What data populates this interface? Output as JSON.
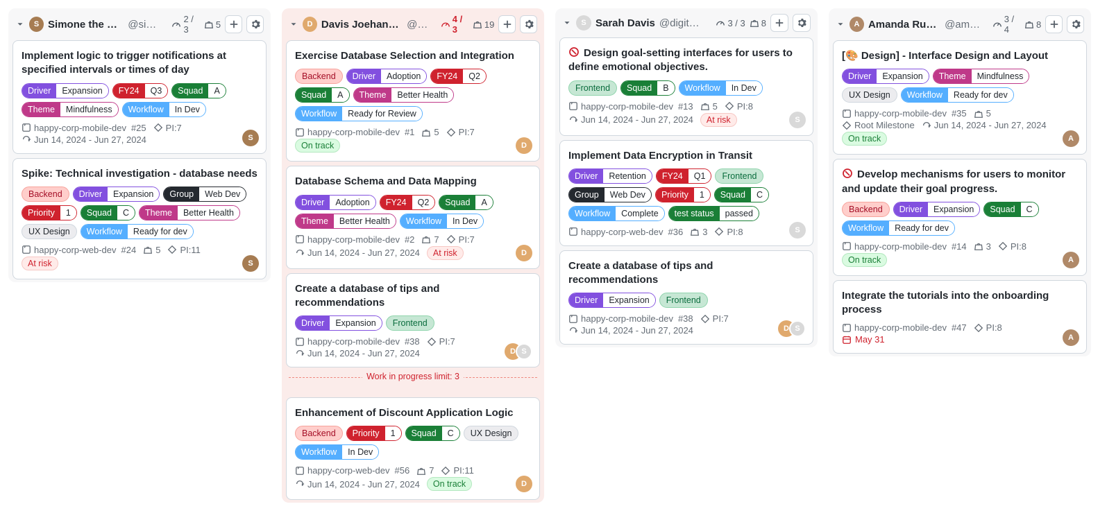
{
  "columns": [
    {
      "id": "simone",
      "over": false,
      "avatarBg": "#a67c52",
      "avatarInitials": "S",
      "name": "Simone the SET",
      "handle": "@sim…",
      "limitText": "2 / 3",
      "limitOver": false,
      "weight": "5",
      "cards": [
        {
          "title": "Implement logic to trigger notifications at specified intervals or times of day",
          "tags": [
            {
              "type": "split",
              "k": "Driver",
              "v": "Expansion",
              "bg": "#8250df",
              "border": "#8250df"
            },
            {
              "type": "split",
              "k": "FY24",
              "v": "Q3",
              "bg": "#cf222e",
              "border": "#cf222e"
            },
            {
              "type": "split",
              "k": "Squad",
              "v": "A",
              "bg": "#1a7f37",
              "border": "#1a7f37"
            },
            {
              "type": "split",
              "k": "Theme",
              "v": "Mindfulness",
              "bg": "#bf3989",
              "border": "#bf3989"
            },
            {
              "type": "split",
              "k": "Workflow",
              "v": "In Dev",
              "bg": "#54aeff",
              "border": "#54aeff"
            }
          ],
          "repo": "happy-corp-mobile-dev",
          "num": "#25",
          "pi": "PI:7",
          "dates": "Jun 14, 2024 - Jun 27, 2024",
          "assignees": [
            {
              "bg": "#a67c52",
              "ini": "S"
            }
          ]
        },
        {
          "title": "Spike: Technical investigation - database needs",
          "tags": [
            {
              "type": "solid",
              "label": "Backend",
              "bg": "#ffcecb",
              "fg": "#a40e26",
              "border": "#f7a39c"
            },
            {
              "type": "split",
              "k": "Driver",
              "v": "Expansion",
              "bg": "#8250df",
              "border": "#8250df"
            },
            {
              "type": "split",
              "k": "Group",
              "v": "Web Dev",
              "bg": "#24292f",
              "border": "#24292f"
            },
            {
              "type": "split",
              "k": "Priority",
              "v": "1",
              "bg": "#cf222e",
              "border": "#cf222e"
            },
            {
              "type": "split",
              "k": "Squad",
              "v": "C",
              "bg": "#1a7f37",
              "border": "#1a7f37"
            },
            {
              "type": "split",
              "k": "Theme",
              "v": "Better Health",
              "bg": "#bf3989",
              "border": "#bf3989"
            },
            {
              "type": "solid",
              "label": "UX Design",
              "bg": "#ececef",
              "fg": "#24292f",
              "border": "#d0d7de"
            },
            {
              "type": "split",
              "k": "Workflow",
              "v": "Ready for dev",
              "bg": "#54aeff",
              "border": "#54aeff"
            }
          ],
          "repo": "happy-corp-web-dev",
          "num": "#24",
          "weight": "5",
          "pi": "PI:11",
          "status": "At risk",
          "statusClass": "status-atrisk",
          "assignees": [
            {
              "bg": "#a67c52",
              "ini": "S"
            }
          ]
        }
      ]
    },
    {
      "id": "davis",
      "over": true,
      "avatarBg": "#e0a96d",
      "avatarInitials": "D",
      "name": "Davis Joehanson",
      "handle": "@d…",
      "limitText": "4 / 3",
      "limitOver": true,
      "weight": "19",
      "wipLimitAfter": 3,
      "wipLimitText": "Work in progress limit: 3",
      "cards": [
        {
          "title": "Exercise Database Selection and Integration",
          "tags": [
            {
              "type": "solid",
              "label": "Backend",
              "bg": "#ffcecb",
              "fg": "#a40e26",
              "border": "#f7a39c"
            },
            {
              "type": "split",
              "k": "Driver",
              "v": "Adoption",
              "bg": "#8250df",
              "border": "#8250df"
            },
            {
              "type": "split",
              "k": "FY24",
              "v": "Q2",
              "bg": "#cf222e",
              "border": "#cf222e"
            },
            {
              "type": "split",
              "k": "Squad",
              "v": "A",
              "bg": "#1a7f37",
              "border": "#1a7f37"
            },
            {
              "type": "split",
              "k": "Theme",
              "v": "Better Health",
              "bg": "#bf3989",
              "border": "#bf3989"
            },
            {
              "type": "split",
              "k": "Workflow",
              "v": "Ready for Review",
              "bg": "#54aeff",
              "border": "#54aeff"
            }
          ],
          "repo": "happy-corp-mobile-dev",
          "num": "#1",
          "weight": "5",
          "pi": "PI:7",
          "status": "On track",
          "statusClass": "status-ontrack",
          "assignees": [
            {
              "bg": "#e0a96d",
              "ini": "D"
            }
          ]
        },
        {
          "title": "Database Schema and Data Mapping",
          "tags": [
            {
              "type": "split",
              "k": "Driver",
              "v": "Adoption",
              "bg": "#8250df",
              "border": "#8250df"
            },
            {
              "type": "split",
              "k": "FY24",
              "v": "Q2",
              "bg": "#cf222e",
              "border": "#cf222e"
            },
            {
              "type": "split",
              "k": "Squad",
              "v": "A",
              "bg": "#1a7f37",
              "border": "#1a7f37"
            },
            {
              "type": "split",
              "k": "Theme",
              "v": "Better Health",
              "bg": "#bf3989",
              "border": "#bf3989"
            },
            {
              "type": "split",
              "k": "Workflow",
              "v": "In Dev",
              "bg": "#54aeff",
              "border": "#54aeff"
            }
          ],
          "repo": "happy-corp-mobile-dev",
          "num": "#2",
          "weight": "7",
          "pi": "PI:7",
          "dates": "Jun 14, 2024 - Jun 27, 2024",
          "status": "At risk",
          "statusClass": "status-atrisk",
          "assignees": [
            {
              "bg": "#e0a96d",
              "ini": "D"
            }
          ]
        },
        {
          "title": "Create a database of tips and recommendations",
          "tags": [
            {
              "type": "split",
              "k": "Driver",
              "v": "Expansion",
              "bg": "#8250df",
              "border": "#8250df"
            },
            {
              "type": "solid",
              "label": "Frontend",
              "bg": "#c6e7d4",
              "fg": "#0a6c3d",
              "border": "#8fd4ac"
            }
          ],
          "repo": "happy-corp-mobile-dev",
          "num": "#38",
          "pi": "PI:7",
          "dates": "Jun 14, 2024 - Jun 27, 2024",
          "assignees": [
            {
              "bg": "#e0a96d",
              "ini": "D"
            },
            {
              "bg": "#d9d9d9",
              "ini": "S"
            }
          ]
        },
        {
          "title": "Enhancement of Discount Application Logic",
          "tags": [
            {
              "type": "solid",
              "label": "Backend",
              "bg": "#ffcecb",
              "fg": "#a40e26",
              "border": "#f7a39c"
            },
            {
              "type": "split",
              "k": "Priority",
              "v": "1",
              "bg": "#cf222e",
              "border": "#cf222e"
            },
            {
              "type": "split",
              "k": "Squad",
              "v": "C",
              "bg": "#1a7f37",
              "border": "#1a7f37"
            },
            {
              "type": "solid",
              "label": "UX Design",
              "bg": "#ececef",
              "fg": "#24292f",
              "border": "#d0d7de"
            },
            {
              "type": "split",
              "k": "Workflow",
              "v": "In Dev",
              "bg": "#54aeff",
              "border": "#54aeff"
            }
          ],
          "repo": "happy-corp-web-dev",
          "num": "#56",
          "weight": "7",
          "pi": "PI:11",
          "dates": "Jun 14, 2024 - Jun 27, 2024",
          "status": "On track",
          "statusClass": "status-ontrack",
          "assignees": [
            {
              "bg": "#e0a96d",
              "ini": "D"
            }
          ]
        }
      ]
    },
    {
      "id": "sarah",
      "over": false,
      "avatarBg": "#d9d9d9",
      "avatarInitials": "S",
      "name": "Sarah Davis",
      "handle": "@digitalpr…",
      "limitText": "3 / 3",
      "limitOver": false,
      "weight": "8",
      "cards": [
        {
          "blocked": true,
          "title": "Design goal-setting interfaces for users to define emotional objectives.",
          "tags": [
            {
              "type": "solid",
              "label": "Frontend",
              "bg": "#c6e7d4",
              "fg": "#0a6c3d",
              "border": "#8fd4ac"
            },
            {
              "type": "split",
              "k": "Squad",
              "v": "B",
              "bg": "#1a7f37",
              "border": "#1a7f37"
            },
            {
              "type": "split",
              "k": "Workflow",
              "v": "In Dev",
              "bg": "#54aeff",
              "border": "#54aeff"
            }
          ],
          "repo": "happy-corp-mobile-dev",
          "num": "#13",
          "weight": "5",
          "pi": "PI:8",
          "dates": "Jun 14, 2024 - Jun 27, 2024",
          "status": "At risk",
          "statusClass": "status-atrisk",
          "assignees": [
            {
              "bg": "#d9d9d9",
              "ini": "S"
            }
          ]
        },
        {
          "title": "Implement Data Encryption in Transit",
          "tags": [
            {
              "type": "split",
              "k": "Driver",
              "v": "Retention",
              "bg": "#8250df",
              "border": "#8250df"
            },
            {
              "type": "split",
              "k": "FY24",
              "v": "Q1",
              "bg": "#cf222e",
              "border": "#cf222e"
            },
            {
              "type": "solid",
              "label": "Frontend",
              "bg": "#c6e7d4",
              "fg": "#0a6c3d",
              "border": "#8fd4ac"
            },
            {
              "type": "split",
              "k": "Group",
              "v": "Web Dev",
              "bg": "#24292f",
              "border": "#24292f"
            },
            {
              "type": "split",
              "k": "Priority",
              "v": "1",
              "bg": "#cf222e",
              "border": "#cf222e"
            },
            {
              "type": "split",
              "k": "Squad",
              "v": "C",
              "bg": "#1a7f37",
              "border": "#1a7f37"
            },
            {
              "type": "split",
              "k": "Workflow",
              "v": "Complete",
              "bg": "#54aeff",
              "border": "#54aeff"
            },
            {
              "type": "split",
              "k": "test status",
              "v": "passed",
              "bg": "#1a7f37",
              "border": "#1a7f37"
            }
          ],
          "repo": "happy-corp-web-dev",
          "num": "#36",
          "weight": "3",
          "pi": "PI:8",
          "assignees": [
            {
              "bg": "#d9d9d9",
              "ini": "S"
            }
          ]
        },
        {
          "title": "Create a database of tips and recommendations",
          "tags": [
            {
              "type": "split",
              "k": "Driver",
              "v": "Expansion",
              "bg": "#8250df",
              "border": "#8250df"
            },
            {
              "type": "solid",
              "label": "Frontend",
              "bg": "#c6e7d4",
              "fg": "#0a6c3d",
              "border": "#8fd4ac"
            }
          ],
          "repo": "happy-corp-mobile-dev",
          "num": "#38",
          "pi": "PI:7",
          "dates": "Jun 14, 2024 - Jun 27, 2024",
          "assignees": [
            {
              "bg": "#e0a96d",
              "ini": "D"
            },
            {
              "bg": "#d9d9d9",
              "ini": "S"
            }
          ]
        }
      ]
    },
    {
      "id": "amanda",
      "over": false,
      "avatarBg": "#b08968",
      "avatarInitials": "A",
      "name": "Amanda Rueda",
      "handle": "@ama…",
      "limitText": "3 / 4",
      "limitOver": false,
      "weight": "8",
      "cards": [
        {
          "titleEmoji": "🎨",
          "title": "[🎨 Design] - Interface Design and Layout",
          "renderTitle": "Design] - Interface Design and Layout",
          "titlePrefix": "[",
          "tags": [
            {
              "type": "split",
              "k": "Driver",
              "v": "Expansion",
              "bg": "#8250df",
              "border": "#8250df"
            },
            {
              "type": "split",
              "k": "Theme",
              "v": "Mindfulness",
              "bg": "#bf3989",
              "border": "#bf3989"
            },
            {
              "type": "solid",
              "label": "UX Design",
              "bg": "#ececef",
              "fg": "#24292f",
              "border": "#d0d7de"
            },
            {
              "type": "split",
              "k": "Workflow",
              "v": "Ready for dev",
              "bg": "#54aeff",
              "border": "#54aeff"
            }
          ],
          "repo": "happy-corp-mobile-dev",
          "num": "#35",
          "weight": "5",
          "milestone": "Root Milestone",
          "dates": "Jun 14, 2024 - Jun 27, 2024",
          "status": "On track",
          "statusClass": "status-ontrack",
          "assignees": [
            {
              "bg": "#b08968",
              "ini": "A"
            }
          ]
        },
        {
          "blocked": true,
          "title": "Develop mechanisms for users to monitor and update their goal progress.",
          "tags": [
            {
              "type": "solid",
              "label": "Backend",
              "bg": "#ffcecb",
              "fg": "#a40e26",
              "border": "#f7a39c"
            },
            {
              "type": "split",
              "k": "Driver",
              "v": "Expansion",
              "bg": "#8250df",
              "border": "#8250df"
            },
            {
              "type": "split",
              "k": "Squad",
              "v": "C",
              "bg": "#1a7f37",
              "border": "#1a7f37"
            },
            {
              "type": "split",
              "k": "Workflow",
              "v": "Ready for dev",
              "bg": "#54aeff",
              "border": "#54aeff"
            }
          ],
          "repo": "happy-corp-mobile-dev",
          "num": "#14",
          "weight": "3",
          "pi": "PI:8",
          "status": "On track",
          "statusClass": "status-ontrack",
          "assignees": [
            {
              "bg": "#b08968",
              "ini": "A"
            }
          ]
        },
        {
          "title": "Integrate the tutorials into the onboarding process",
          "tags": [],
          "repo": "happy-corp-mobile-dev",
          "num": "#47",
          "pi": "PI:8",
          "dueDate": "May 31",
          "assignees": [
            {
              "bg": "#b08968",
              "ini": "A"
            }
          ]
        }
      ]
    }
  ]
}
